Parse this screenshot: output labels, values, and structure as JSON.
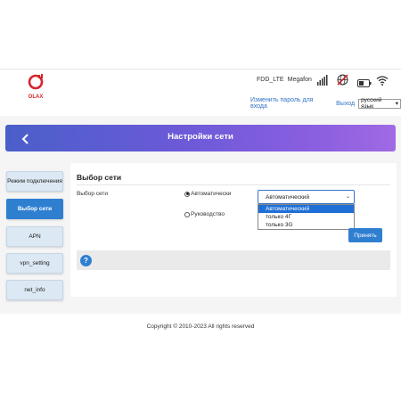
{
  "header": {
    "logo_text": "OLAX",
    "network_type": "FDD_LTE",
    "operator": "Megafon",
    "change_password": "Изменить пароль для входа",
    "logout": "Выход",
    "language": "русский язык"
  },
  "page": {
    "title": "Настройки сети"
  },
  "sidebar": {
    "items": [
      {
        "label": "Режим подключения"
      },
      {
        "label": "Выбор сети"
      },
      {
        "label": "APN"
      },
      {
        "label": "vpn_setting"
      },
      {
        "label": "net_info"
      }
    ]
  },
  "main": {
    "section_title": "Выбор сети",
    "field_label": "Выбор сети",
    "radio_auto": "Автоматически",
    "radio_manual": "Руководство",
    "select_value": "Автоматический",
    "options": [
      "Автоматический",
      "только 4Г",
      "только 3G"
    ],
    "apply_label": "Принять"
  },
  "footer": {
    "copyright": "Copyright © 2010-2023 All rights reserved"
  },
  "colors": {
    "accent": "#2f7fd1",
    "logo_red": "#d6262b"
  }
}
